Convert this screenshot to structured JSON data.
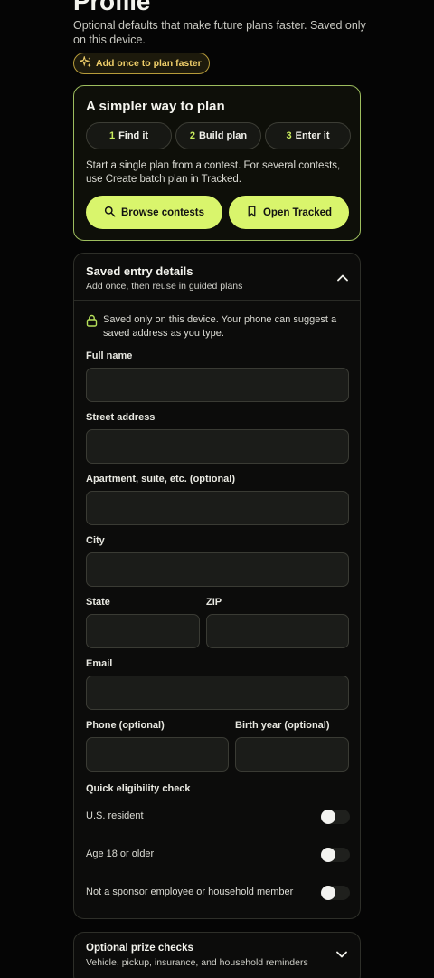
{
  "page": {
    "title": "Profile",
    "intro": "Optional defaults that make future plans faster. Saved only on this device.",
    "badge_label": "Add once to plan faster",
    "badge_icon": "sparkle-icon"
  },
  "plan_card": {
    "title": "A simpler way to plan",
    "steps": [
      {
        "num": "1",
        "label": "Find it"
      },
      {
        "num": "2",
        "label": "Build plan"
      },
      {
        "num": "3",
        "label": "Enter it"
      }
    ],
    "description": "Start a single plan from a contest. For several contests, use Create batch plan in Tracked.",
    "browse_label": "Browse contests",
    "tracked_label": "Open Tracked",
    "accent": "#d9f56c"
  },
  "details": {
    "title": "Saved entry details",
    "subtitle": "Add once, then reuse in guided plans",
    "expanded": true,
    "note": "Saved only on this device. Your phone can suggest a saved address as you type.",
    "fields": {
      "full_name": {
        "label": "Full name",
        "value": ""
      },
      "street": {
        "label": "Street address",
        "value": ""
      },
      "apartment": {
        "label": "Apartment, suite, etc. (optional)",
        "value": ""
      },
      "city": {
        "label": "City",
        "value": ""
      },
      "state": {
        "label": "State",
        "value": ""
      },
      "zip": {
        "label": "ZIP",
        "value": ""
      },
      "email": {
        "label": "Email",
        "value": ""
      },
      "phone": {
        "label": "Phone (optional)",
        "value": ""
      },
      "birth_year": {
        "label": "Birth year (optional)",
        "value": ""
      }
    },
    "eligibility": {
      "title": "Quick eligibility check",
      "items": [
        {
          "label": "U.S. resident",
          "checked": false
        },
        {
          "label": "Age 18 or older",
          "checked": false
        },
        {
          "label": "Not a sponsor employee or household member",
          "checked": false
        }
      ]
    }
  },
  "prize_card": {
    "title": "Optional prize checks",
    "subtitle": "Vehicle, pickup, insurance, and household reminders",
    "expanded": false
  }
}
